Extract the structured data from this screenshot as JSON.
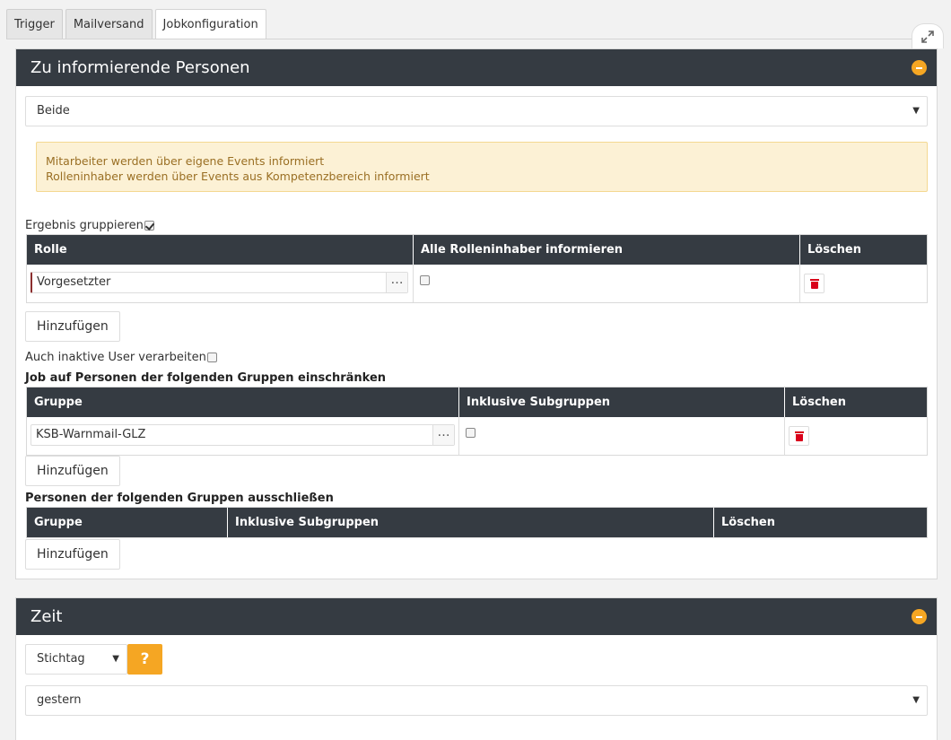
{
  "tabs": [
    {
      "label": "Trigger"
    },
    {
      "label": "Mailversand"
    },
    {
      "label": "Jobkonfiguration"
    }
  ],
  "persons_panel": {
    "title": "Zu informierende Personen",
    "scope_select": "Beide",
    "info_lines": [
      "Mitarbeiter werden über eigene Events informiert",
      "Rolleninhaber werden über Events aus Kompetenzbereich informiert"
    ],
    "group_result_label": "Ergebnis gruppieren",
    "group_result_checked": true,
    "roles_table": {
      "headers": [
        "Rolle",
        "Alle Rolleninhaber informieren",
        "Löschen"
      ],
      "rows": [
        {
          "role": "Vorgesetzter",
          "all_holders": false
        }
      ]
    },
    "add_label": "Hinzufügen",
    "inactive_label": "Auch inaktive User verarbeiten",
    "inactive_checked": false,
    "restrict_heading": "Job auf Personen der folgenden Gruppen einschränken",
    "restrict_table": {
      "headers": [
        "Gruppe",
        "Inklusive Subgruppen",
        "Löschen"
      ],
      "rows": [
        {
          "group": "KSB-Warnmail-GLZ",
          "subgroups": false
        }
      ]
    },
    "exclude_heading": "Personen der folgenden Gruppen ausschließen",
    "exclude_table": {
      "headers": [
        "Gruppe",
        "Inklusive Subgruppen",
        "Löschen"
      ],
      "rows": []
    }
  },
  "time_panel": {
    "title": "Zeit",
    "mode_select": "Stichtag",
    "help_label": "?",
    "period_select": "gestern"
  },
  "icons": {
    "expand": "expand-icon",
    "collapse": "minus-circle-icon",
    "delete": "trash-icon",
    "picker": "ellipsis-icon"
  },
  "colors": {
    "header_bg": "#353b42",
    "accent": "#f5a623",
    "alert_bg": "#fcf1d5",
    "delete_red": "#d9001b"
  }
}
